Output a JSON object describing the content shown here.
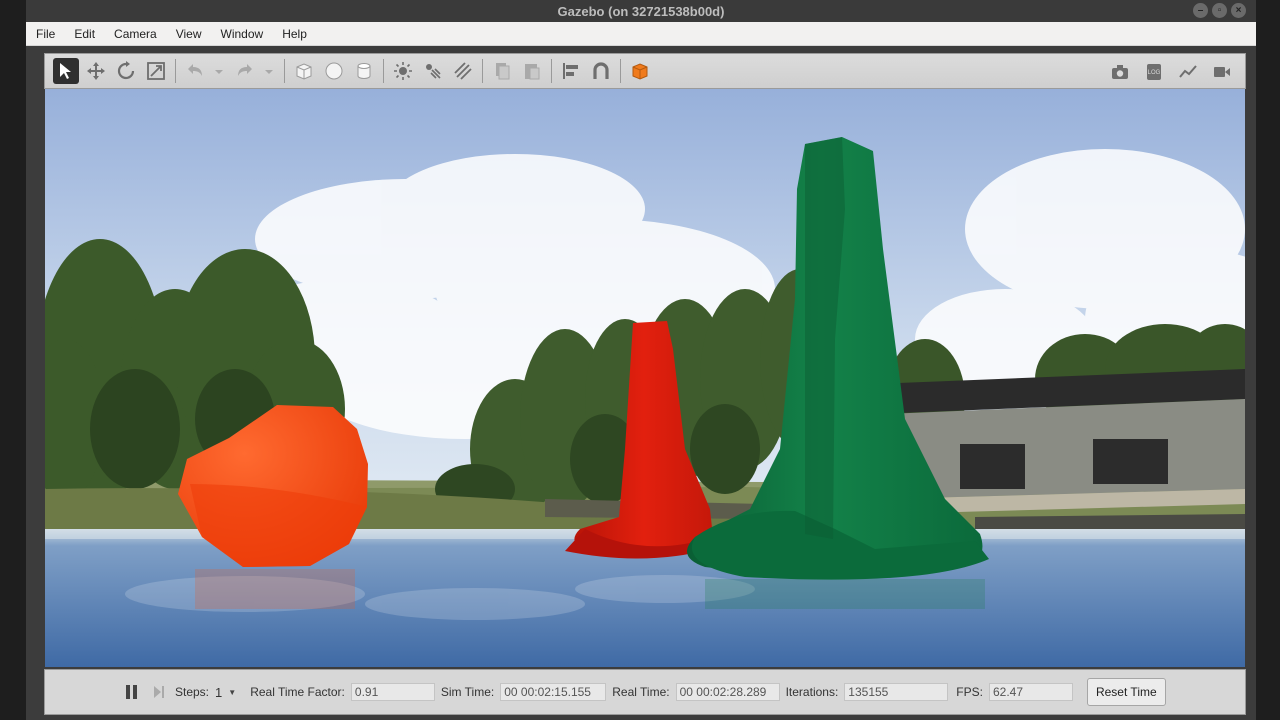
{
  "window": {
    "title": "Gazebo (on 32721538b00d)"
  },
  "menu": [
    "File",
    "Edit",
    "Camera",
    "View",
    "Window",
    "Help"
  ],
  "status": {
    "steps_label": "Steps:",
    "steps_value": "1",
    "rtf_label": "Real Time Factor:",
    "rtf_value": "0.91",
    "sim_time_label": "Sim Time:",
    "sim_time_value": "00 00:02:15.155",
    "real_time_label": "Real Time:",
    "real_time_value": "00 00:02:28.289",
    "iterations_label": "Iterations:",
    "iterations_value": "135155",
    "fps_label": "FPS:",
    "fps_value": "62.47",
    "reset_label": "Reset Time"
  },
  "colors": {
    "sky_top": "#9fb6dc",
    "water": "#5f86b3",
    "orange_buoy": "#ff4a14",
    "red_buoy": "#d91a0a",
    "green_buoy": "#0f7a44"
  },
  "icons": {
    "toolbar": [
      "select-arrow-icon",
      "translate-icon",
      "rotate-icon",
      "scale-icon",
      "undo-icon",
      "redo-icon",
      "box-icon",
      "sphere-icon",
      "cylinder-icon",
      "point-light-icon",
      "spot-light-icon",
      "directional-light-icon",
      "copy-icon",
      "paste-icon",
      "align-icon",
      "snap-icon",
      "view-angle-icon",
      "screenshot-icon",
      "log-icon",
      "plot-icon",
      "video-record-icon"
    ]
  }
}
